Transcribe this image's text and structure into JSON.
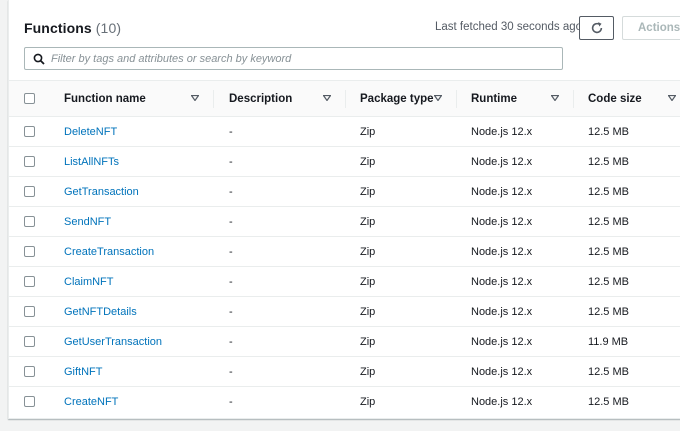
{
  "header": {
    "title": "Functions",
    "count": "(10)",
    "last_fetched": "Last fetched 30 seconds ago",
    "actions_label": "Actions"
  },
  "search": {
    "placeholder": "Filter by tags and attributes or search by keyword"
  },
  "columns": [
    {
      "label": "Function name"
    },
    {
      "label": "Description"
    },
    {
      "label": "Package type"
    },
    {
      "label": "Runtime"
    },
    {
      "label": "Code size"
    }
  ],
  "rows": [
    {
      "name": "DeleteNFT",
      "description": "-",
      "package": "Zip",
      "runtime": "Node.js 12.x",
      "size": "12.5 MB"
    },
    {
      "name": "ListAllNFTs",
      "description": "-",
      "package": "Zip",
      "runtime": "Node.js 12.x",
      "size": "12.5 MB"
    },
    {
      "name": "GetTransaction",
      "description": "-",
      "package": "Zip",
      "runtime": "Node.js 12.x",
      "size": "12.5 MB"
    },
    {
      "name": "SendNFT",
      "description": "-",
      "package": "Zip",
      "runtime": "Node.js 12.x",
      "size": "12.5 MB"
    },
    {
      "name": "CreateTransaction",
      "description": "-",
      "package": "Zip",
      "runtime": "Node.js 12.x",
      "size": "12.5 MB"
    },
    {
      "name": "ClaimNFT",
      "description": "-",
      "package": "Zip",
      "runtime": "Node.js 12.x",
      "size": "12.5 MB"
    },
    {
      "name": "GetNFTDetails",
      "description": "-",
      "package": "Zip",
      "runtime": "Node.js 12.x",
      "size": "12.5 MB"
    },
    {
      "name": "GetUserTransaction",
      "description": "-",
      "package": "Zip",
      "runtime": "Node.js 12.x",
      "size": "11.9 MB"
    },
    {
      "name": "GiftNFT",
      "description": "-",
      "package": "Zip",
      "runtime": "Node.js 12.x",
      "size": "12.5 MB"
    },
    {
      "name": "CreateNFT",
      "description": "-",
      "package": "Zip",
      "runtime": "Node.js 12.x",
      "size": "12.5 MB"
    }
  ],
  "icons": {
    "refresh": "refresh-icon",
    "search": "search-icon",
    "sort": "caret-down-icon"
  },
  "colors": {
    "link": "#0073bb",
    "text": "#16191f",
    "muted": "#687078",
    "border": "#eaeded"
  }
}
